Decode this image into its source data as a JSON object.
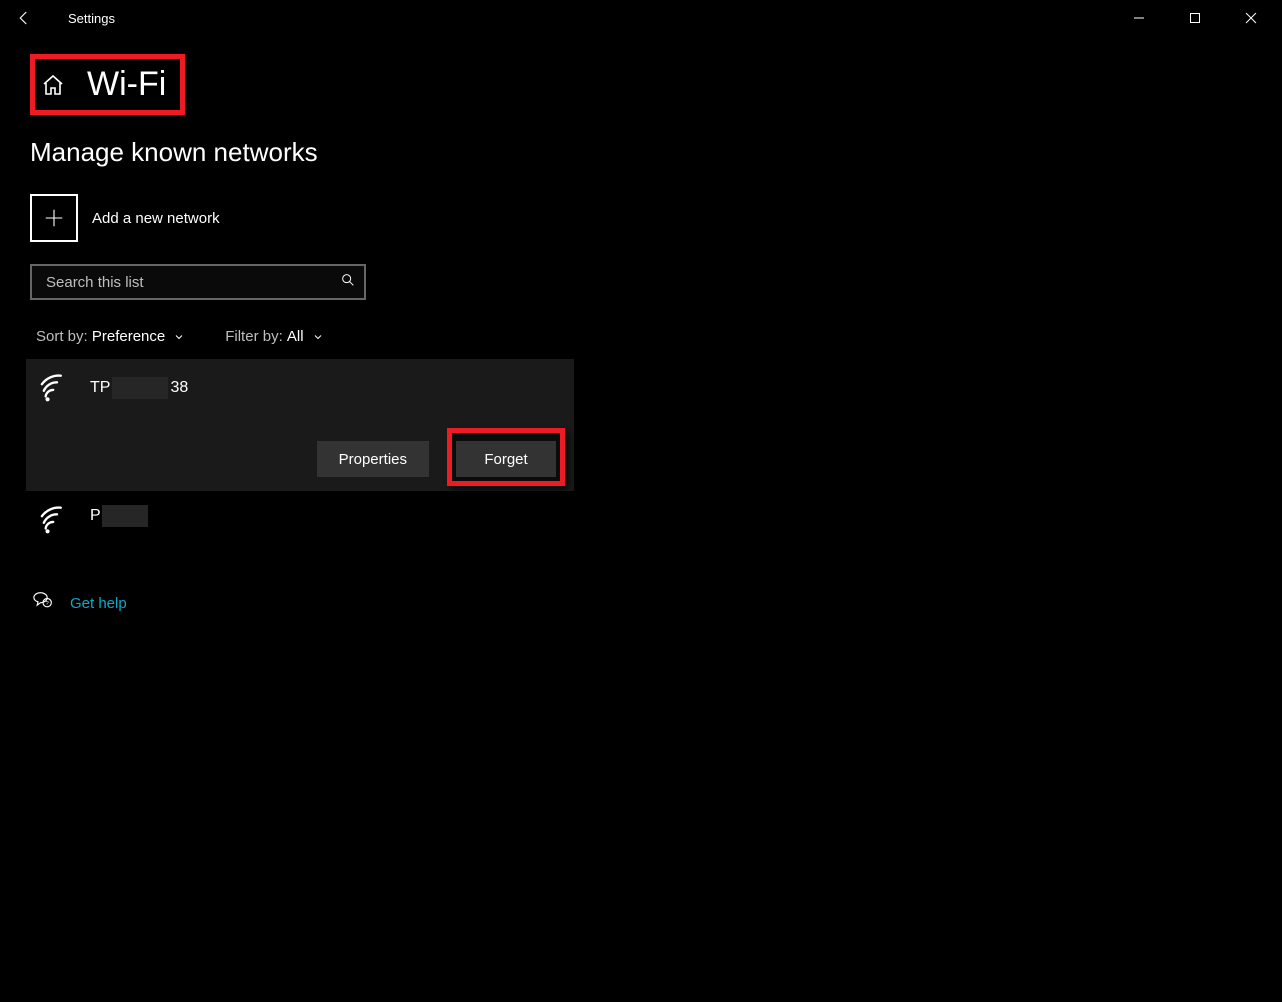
{
  "window": {
    "title": "Settings"
  },
  "page": {
    "hero_title": "Wi-Fi",
    "section_title": "Manage known networks",
    "add_label": "Add a new network",
    "search_placeholder": "Search this list",
    "sort_label": "Sort by:",
    "sort_value": "Preference",
    "filter_label": "Filter by:",
    "filter_value": "All",
    "properties_label": "Properties",
    "forget_label": "Forget",
    "help_label": "Get help"
  },
  "networks": [
    {
      "name_prefix": "TP",
      "name_suffix": "38",
      "selected": true
    },
    {
      "name_prefix": "P",
      "name_suffix": "",
      "selected": false
    }
  ],
  "highlight_color": "#ed1c24"
}
